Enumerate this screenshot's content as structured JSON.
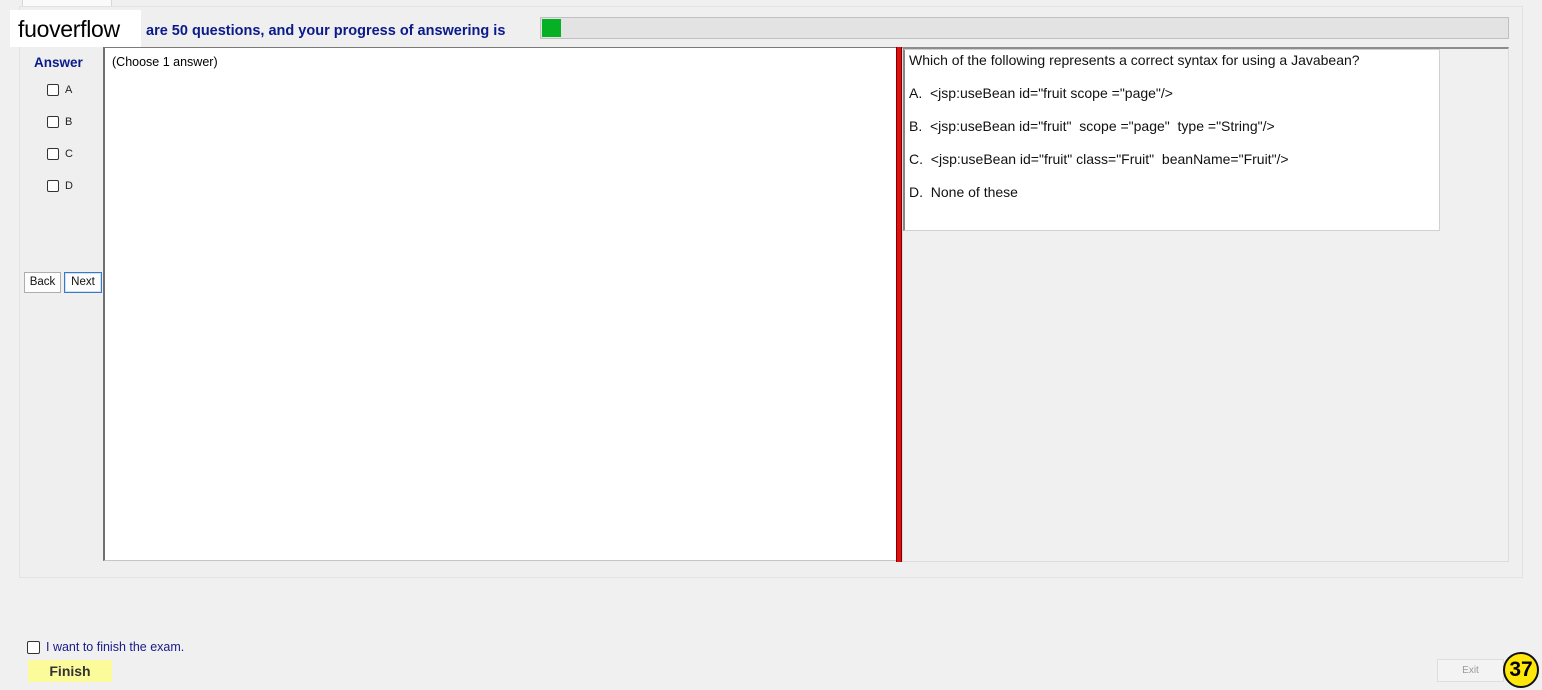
{
  "header": {
    "logo_text": "fuoverflow",
    "progress_text": "are 50 questions, and your progress of answering is",
    "progress_fraction": 0.02
  },
  "answer_panel": {
    "heading": "Answer",
    "options": [
      "A",
      "B",
      "C",
      "D"
    ],
    "back_label": "Back",
    "next_label": "Next"
  },
  "answer_pane": {
    "instruction": "(Choose 1 answer)"
  },
  "question": {
    "text": "Which of the following represents a correct syntax for using a Javabean?",
    "choices": [
      "A.  <jsp:useBean id=\"fruit scope =\"page\"/>",
      "B.  <jsp:useBean id=\"fruit\"  scope =\"page\"  type =\"String\"/>",
      "C.  <jsp:useBean id=\"fruit\" class=\"Fruit\"  beanName=\"Fruit\"/>",
      "D.  None of these"
    ]
  },
  "footer": {
    "finish_check_label": "I want to finish the exam.",
    "finish_label": "Finish",
    "exit_label": "Exit",
    "badge_number": "37"
  },
  "colors": {
    "progress_green": "#06b025",
    "splitter_red": "#e10f0f",
    "heading_blue": "#0a1a8a",
    "finish_yellow": "#fbfb9b",
    "badge_yellow": "#ffe70a"
  }
}
